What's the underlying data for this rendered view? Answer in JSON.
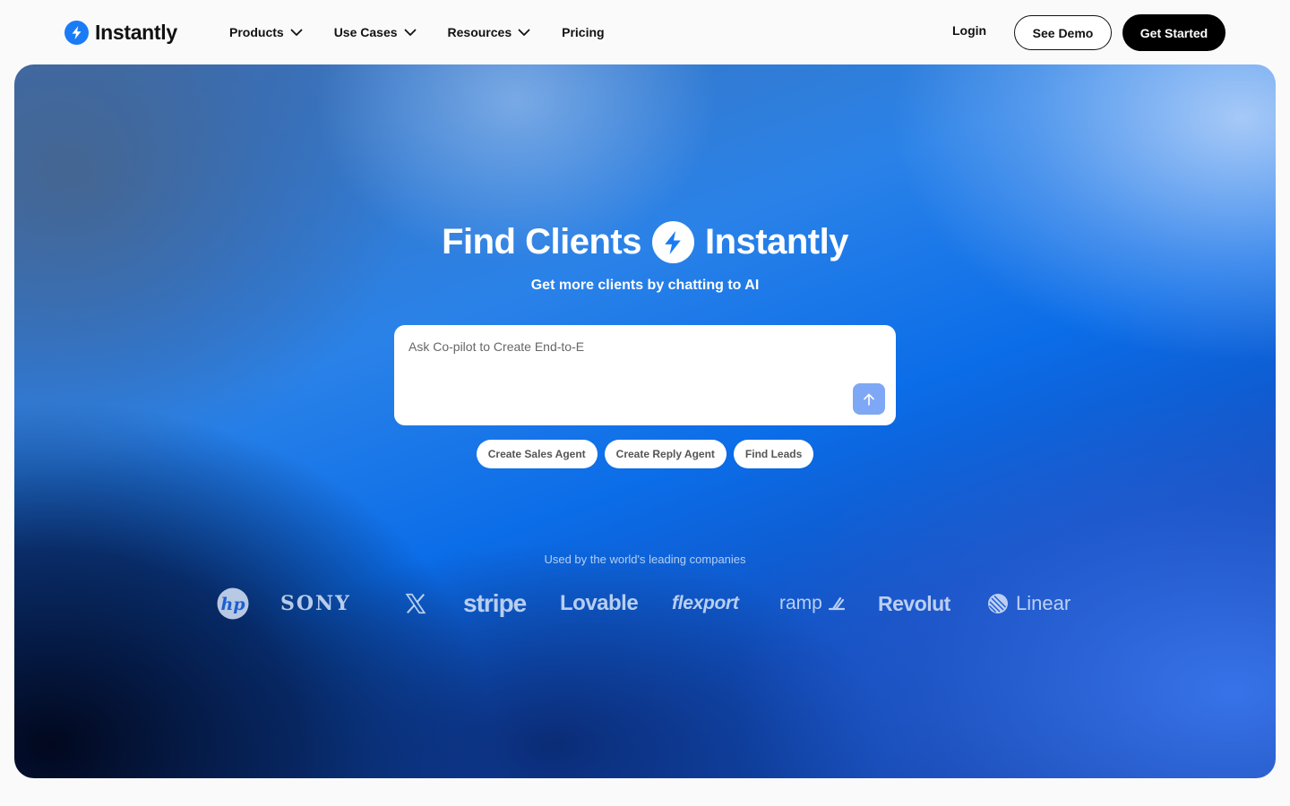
{
  "header": {
    "brand": "Instantly",
    "nav": [
      {
        "label": "Products",
        "has_dropdown": true
      },
      {
        "label": "Use Cases",
        "has_dropdown": true
      },
      {
        "label": "Resources",
        "has_dropdown": true
      },
      {
        "label": "Pricing",
        "has_dropdown": false
      }
    ],
    "login_label": "Login",
    "demo_label": "See Demo",
    "start_label": "Get Started"
  },
  "hero": {
    "title_left": "Find Clients",
    "title_right": "Instantly",
    "subtitle": "Get more clients by chatting to AI",
    "prompt_value": "Ask Co-pilot to Create End-to-E",
    "chips": [
      "Create Sales Agent",
      "Create Reply Agent",
      "Find Leads"
    ],
    "used_by": "Used by the world's leading companies",
    "companies": [
      "hp",
      "SONY",
      "X",
      "stripe",
      "Lovable",
      "flexport",
      "ramp",
      "Revolut",
      "Linear"
    ]
  },
  "icons": {
    "logo": "bolt-icon",
    "dropdown": "chevron-down-icon",
    "send": "arrow-up-icon"
  },
  "colors": {
    "brand_blue": "#1a7cf5",
    "cta_black": "#000000",
    "send_button": "#7ea8f5"
  }
}
